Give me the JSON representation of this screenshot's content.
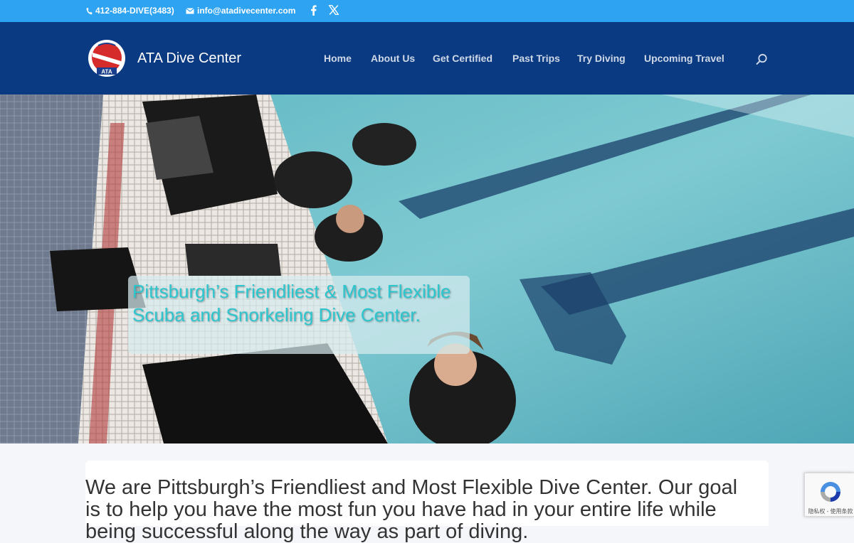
{
  "topbar": {
    "phone": "412-884-DIVE(3483)",
    "email": "info@atadivecenter.com",
    "social": [
      "facebook-icon",
      "x-icon"
    ],
    "background": "#2ea3f2"
  },
  "header": {
    "site_title": "ATA Dive Center",
    "logo_text": "ATA",
    "background": "#0a3a82",
    "nav": [
      {
        "label": "Home"
      },
      {
        "label": "About Us"
      },
      {
        "label": "Get Certified"
      },
      {
        "label": "Past Trips"
      },
      {
        "label": "Try Diving"
      },
      {
        "label": "Upcoming Travel"
      }
    ]
  },
  "hero": {
    "headline": "Pittsburgh’s Friendliest & Most Flexible Scuba and Snorkeling Dive Center.",
    "headline_color": "#2dc6cf"
  },
  "main": {
    "intro": "We are Pittsburgh’s Friendliest and Most Flexible Dive Center. Our goal is to help you have the most fun you have had in your entire life while being successful along the way as part of diving."
  },
  "recaptcha": {
    "label": "隐私权 - 使用条款"
  }
}
